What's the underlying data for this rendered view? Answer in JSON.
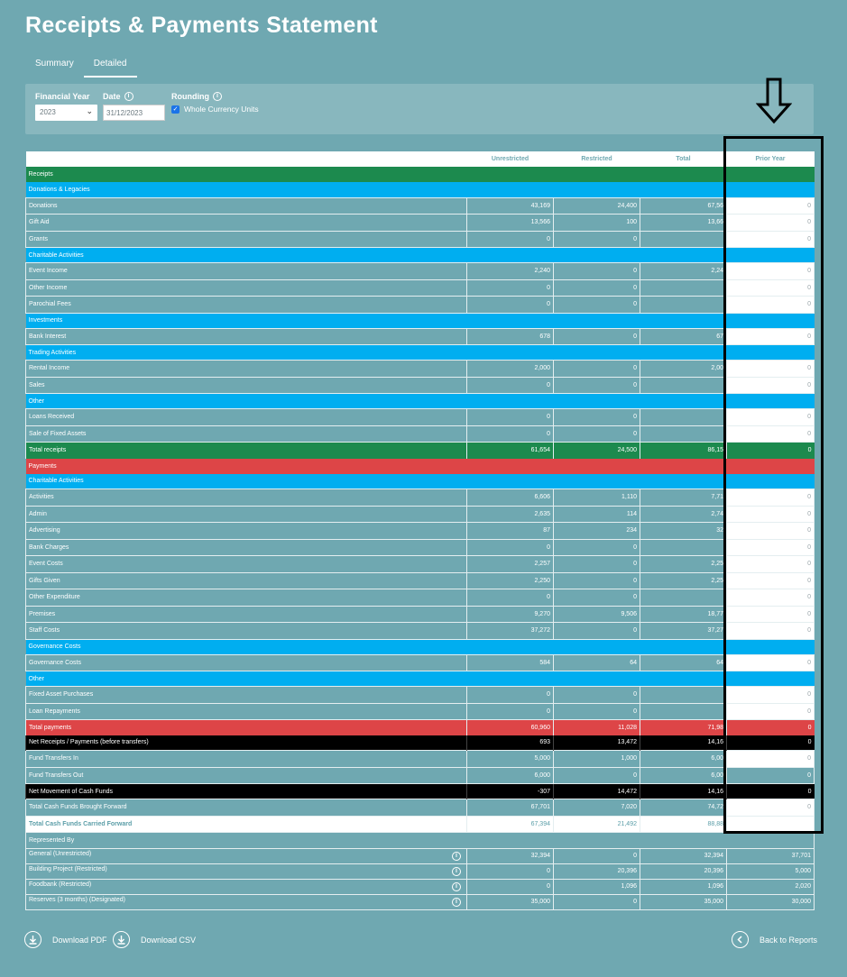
{
  "page": {
    "title": "Receipts & Payments Statement"
  },
  "tabs": [
    "Summary",
    "Detailed"
  ],
  "filters": {
    "financial_year_label": "Financial Year",
    "financial_year_value": "2023",
    "date_label": "Date",
    "date_value": "31/12/2023",
    "rounding_label": "Rounding",
    "rounding_option": "Whole Currency Units",
    "rounding_checked": true
  },
  "columns": [
    "Unrestricted",
    "Restricted",
    "Total",
    "Prior Year"
  ],
  "colors": {
    "background": "#6fa8b1",
    "green": "#1c8a4e",
    "blue": "#00aef0",
    "red": "#dd4547",
    "black": "#000000"
  },
  "rows": [
    {
      "type": "sec-green",
      "label": "Receipts"
    },
    {
      "type": "sec-blue",
      "label": "Donations & Legacies"
    },
    {
      "type": "data",
      "label": "Donations",
      "v": [
        "43,169",
        "24,400",
        "67,56",
        "0"
      ]
    },
    {
      "type": "data",
      "label": "Gift Aid",
      "v": [
        "13,566",
        "100",
        "13,66",
        "0"
      ]
    },
    {
      "type": "data",
      "label": "Grants",
      "v": [
        "0",
        "0",
        "",
        "0"
      ]
    },
    {
      "type": "sec-blue",
      "label": "Charitable Activities"
    },
    {
      "type": "data",
      "label": "Event Income",
      "v": [
        "2,240",
        "0",
        "2,24",
        "0"
      ]
    },
    {
      "type": "data",
      "label": "Other Income",
      "v": [
        "0",
        "0",
        "",
        "0"
      ]
    },
    {
      "type": "data",
      "label": "Parochial Fees",
      "v": [
        "0",
        "0",
        "",
        "0"
      ]
    },
    {
      "type": "sec-blue",
      "label": "Investments"
    },
    {
      "type": "data",
      "label": "Bank Interest",
      "v": [
        "678",
        "0",
        "67",
        "0"
      ]
    },
    {
      "type": "sec-blue",
      "label": "Trading Activities"
    },
    {
      "type": "data",
      "label": "Rental Income",
      "v": [
        "2,000",
        "0",
        "2,00",
        "0"
      ]
    },
    {
      "type": "data",
      "label": "Sales",
      "v": [
        "0",
        "0",
        "",
        "0"
      ]
    },
    {
      "type": "sec-blue",
      "label": "Other"
    },
    {
      "type": "data",
      "label": "Loans Received",
      "v": [
        "0",
        "0",
        "",
        "0"
      ]
    },
    {
      "type": "data",
      "label": "Sale of Fixed Assets",
      "v": [
        "0",
        "0",
        "",
        "0"
      ]
    },
    {
      "type": "total-green",
      "label": "Total receipts",
      "v": [
        "61,654",
        "24,500",
        "86,15",
        "0"
      ]
    },
    {
      "type": "sec-red",
      "label": "Payments"
    },
    {
      "type": "sec-blue",
      "label": "Charitable Activities"
    },
    {
      "type": "data",
      "label": "Activities",
      "v": [
        "6,606",
        "1,110",
        "7,71",
        "0"
      ]
    },
    {
      "type": "data",
      "label": "Admin",
      "v": [
        "2,635",
        "114",
        "2,74",
        "0"
      ]
    },
    {
      "type": "data",
      "label": "Advertising",
      "v": [
        "87",
        "234",
        "32",
        "0"
      ]
    },
    {
      "type": "data",
      "label": "Bank Charges",
      "v": [
        "0",
        "0",
        "",
        "0"
      ]
    },
    {
      "type": "data",
      "label": "Event Costs",
      "v": [
        "2,257",
        "0",
        "2,25",
        "0"
      ]
    },
    {
      "type": "data",
      "label": "Gifts Given",
      "v": [
        "2,250",
        "0",
        "2,25",
        "0"
      ]
    },
    {
      "type": "data",
      "label": "Other Expenditure",
      "v": [
        "0",
        "0",
        "",
        "0"
      ]
    },
    {
      "type": "data",
      "label": "Premises",
      "v": [
        "9,270",
        "9,506",
        "18,77",
        "0"
      ]
    },
    {
      "type": "data",
      "label": "Staff Costs",
      "v": [
        "37,272",
        "0",
        "37,27",
        "0"
      ]
    },
    {
      "type": "sec-blue",
      "label": "Governance Costs"
    },
    {
      "type": "data",
      "label": "Governance Costs",
      "v": [
        "584",
        "64",
        "64",
        "0"
      ]
    },
    {
      "type": "sec-blue",
      "label": "Other"
    },
    {
      "type": "data",
      "label": "Fixed Asset Purchases",
      "v": [
        "0",
        "0",
        "",
        "0"
      ]
    },
    {
      "type": "data",
      "label": "Loan Repayments",
      "v": [
        "0",
        "0",
        "",
        "0"
      ]
    },
    {
      "type": "total-red",
      "label": "Total payments",
      "v": [
        "60,960",
        "11,028",
        "71,98",
        "0"
      ]
    },
    {
      "type": "black",
      "label": "Net Receipts / Payments (before transfers)",
      "v": [
        "693",
        "13,472",
        "14,16",
        "0"
      ]
    },
    {
      "type": "data",
      "label": "Fund Transfers In",
      "v": [
        "5,000",
        "1,000",
        "6,00",
        "0"
      ]
    },
    {
      "type": "data-teal",
      "label": "Fund Transfers Out",
      "v": [
        "6,000",
        "0",
        "6,00",
        "0"
      ]
    },
    {
      "type": "black",
      "label": "Net Movement of Cash Funds",
      "v": [
        "-307",
        "14,472",
        "14,16",
        "0"
      ]
    },
    {
      "type": "data",
      "label": "Total Cash Funds Brought Forward",
      "v": [
        "67,701",
        "7,020",
        "74,72",
        "0"
      ]
    },
    {
      "type": "carried",
      "label": "Total Cash Funds Carried Forward",
      "v": [
        "67,394",
        "21,492",
        "88,88",
        ""
      ]
    },
    {
      "type": "rep-hdr",
      "label": "Represented By"
    },
    {
      "type": "rep",
      "label": "General (Unrestricted)",
      "v": [
        "32,394",
        "0",
        "32,394",
        "37,701"
      ]
    },
    {
      "type": "rep",
      "label": "Building Project (Restricted)",
      "v": [
        "0",
        "20,396",
        "20,396",
        "5,000"
      ]
    },
    {
      "type": "rep",
      "label": "Foodbank (Restricted)",
      "v": [
        "0",
        "1,096",
        "1,096",
        "2,020"
      ]
    },
    {
      "type": "rep",
      "label": "Reserves (3 months) (Designated)",
      "v": [
        "35,000",
        "0",
        "35,000",
        "30,000"
      ]
    }
  ],
  "footer": {
    "download_pdf": "Download PDF",
    "download_csv": "Download CSV",
    "back": "Back to Reports"
  }
}
